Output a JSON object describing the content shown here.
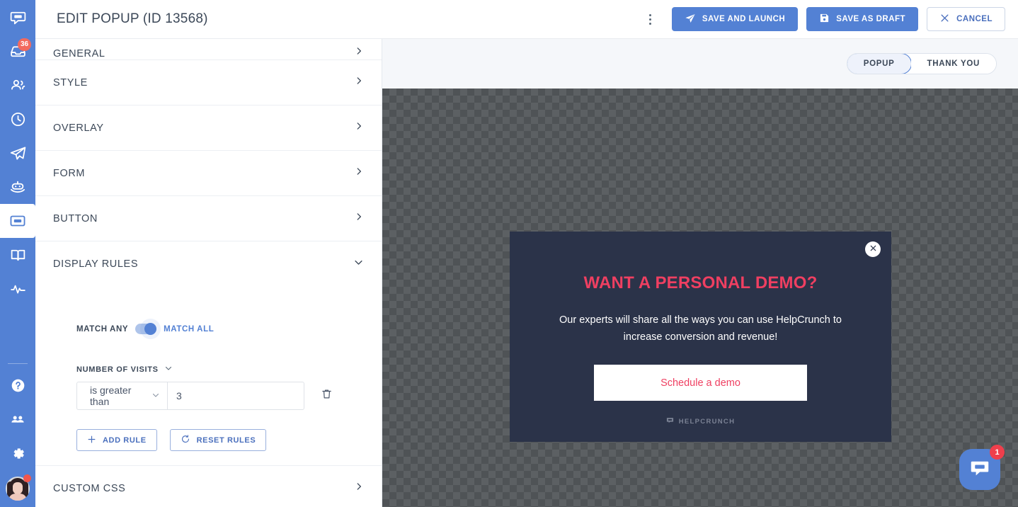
{
  "header": {
    "title": "EDIT POPUP (ID 13568)",
    "kebab_label": "more-options",
    "buttons": {
      "save_launch": "SAVE AND LAUNCH",
      "save_draft": "SAVE AS DRAFT",
      "cancel": "CANCEL"
    }
  },
  "rail": {
    "items": [
      {
        "name": "chat",
        "icon": "chat-bubble-icon",
        "badge": null,
        "active": false
      },
      {
        "name": "inbox",
        "icon": "inbox-icon",
        "badge": "36",
        "active": false
      },
      {
        "name": "contacts",
        "icon": "people-icon",
        "badge": null,
        "active": false
      },
      {
        "name": "history",
        "icon": "clock-icon",
        "badge": null,
        "active": false
      },
      {
        "name": "campaigns",
        "icon": "paper-plane-icon",
        "badge": null,
        "active": false
      },
      {
        "name": "chatbot",
        "icon": "robot-icon",
        "badge": null,
        "active": false
      },
      {
        "name": "popups",
        "icon": "popup-window-icon",
        "badge": null,
        "active": true
      },
      {
        "name": "knowledge-base",
        "icon": "open-book-icon",
        "badge": null,
        "active": false
      },
      {
        "name": "reports",
        "icon": "pulse-icon",
        "badge": null,
        "active": false
      }
    ],
    "bottom_items": [
      {
        "name": "help",
        "icon": "question-circle-icon"
      },
      {
        "name": "team",
        "icon": "team-icon"
      },
      {
        "name": "settings",
        "icon": "gear-icon"
      }
    ],
    "avatar": {
      "name": "user-avatar",
      "badge_dot": true
    }
  },
  "panel": {
    "sections": [
      {
        "id": "general",
        "label": "GENERAL",
        "expanded": false,
        "partial": true
      },
      {
        "id": "style",
        "label": "STYLE",
        "expanded": false,
        "partial": false
      },
      {
        "id": "overlay",
        "label": "OVERLAY",
        "expanded": false,
        "partial": false
      },
      {
        "id": "form",
        "label": "FORM",
        "expanded": false,
        "partial": false
      },
      {
        "id": "button",
        "label": "BUTTON",
        "expanded": false,
        "partial": false
      },
      {
        "id": "display-rules",
        "label": "DISPLAY RULES",
        "expanded": true,
        "partial": false
      },
      {
        "id": "custom-css",
        "label": "CUSTOM CSS",
        "expanded": false,
        "partial": false
      }
    ],
    "display_rules": {
      "match_any_label": "MATCH ANY",
      "match_all_label": "MATCH ALL",
      "toggle_state": "match_all",
      "rule": {
        "attribute_label": "NUMBER OF VISITS",
        "operator": "is greater than",
        "value": "3",
        "value_placeholder": ""
      },
      "add_rule_label": "ADD RULE",
      "reset_rules_label": "RESET RULES"
    }
  },
  "preview": {
    "tabs": [
      {
        "id": "popup",
        "label": "POPUP",
        "active": true
      },
      {
        "id": "thank-you",
        "label": "THANK YOU",
        "active": false
      }
    ],
    "popup": {
      "title": "WANT A PERSONAL DEMO?",
      "subtitle": "Our experts will share all the ways you can use HelpCrunch to increase conversion and revenue!",
      "cta_label": "Schedule a demo",
      "brand": "HELPCRUNCH",
      "close_label": "close"
    },
    "chat_launcher": {
      "badge": "1"
    }
  },
  "colors": {
    "brand_blue": "#5381d4",
    "popup_bg": "#2b3349",
    "accent_pink": "#ef3f61",
    "badge_red": "#f26a5e",
    "panel_bg": "#ffffff",
    "preview_bg": "#f5f7fa"
  }
}
